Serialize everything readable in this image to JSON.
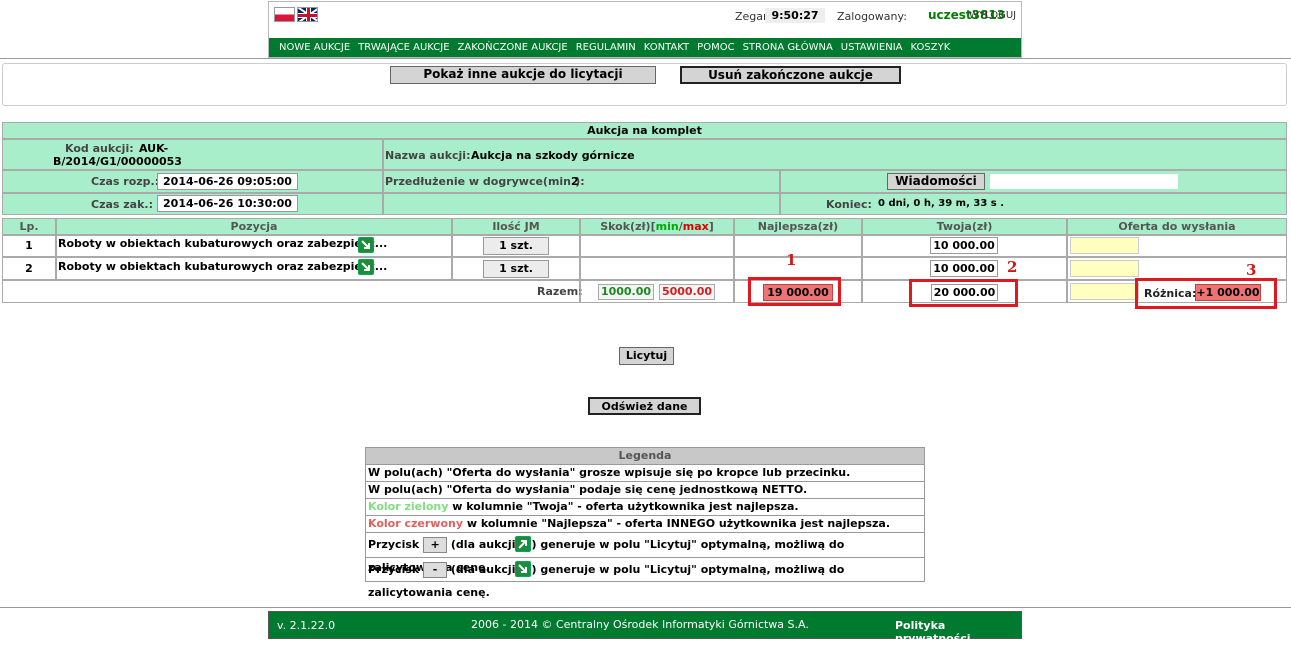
{
  "header": {
    "clock_label": "Zegar:",
    "clock_value": "9:50:27",
    "logged_label": "Zalogowany:",
    "user": "uczest3813",
    "logout": "WYLOGUJ",
    "menu": [
      "NOWE AUKCJE",
      "TRWAJĄCE AUKCJE",
      "ZAKOŃCZONE AUKCJE",
      "REGULAMIN",
      "KONTAKT",
      "POMOC",
      "STRONA GŁÓWNA",
      "USTAWIENIA",
      "KOSZYK"
    ]
  },
  "buttons": {
    "show_other": "Pokaż inne aukcje do licytacji",
    "remove_finished": "Usuń zakończone aukcje",
    "bid": "Licytuj",
    "refresh": "Odśwież dane",
    "messages": "Wiadomości"
  },
  "auction": {
    "title": "Aukcja na komplet",
    "code_label": "Kod aukcji:",
    "code_value": "AUK-B/2014/G1/00000053",
    "name_label": "Nazwa aukcji:",
    "name_value": "Aukcja na szkody górnicze",
    "start_label": "Czas rozp.:",
    "start_value": "2014-06-26 09:05:00",
    "extension_label": "Przedłużenie w dogrywce(min.):",
    "extension_value": "2",
    "end_label": "Czas zak.:",
    "end_value": "2014-06-26 10:30:00",
    "remaining_label": "Koniec:",
    "remaining_value": "0 dni, 0 h, 39 m, 33 s ."
  },
  "table": {
    "columns": [
      "Lp.",
      "Pozycja",
      "Ilość JM",
      "Skok(zł)[",
      "min",
      "/",
      "max",
      "]",
      "Najlepsza(zł)",
      "Twoja(zł)",
      "Oferta do wysłania"
    ],
    "rows": [
      {
        "lp": "1",
        "item": "Roboty w obiektach kubaturowych oraz zabezpiecz...",
        "qty": "1 szt.",
        "yours": "10 000.00"
      },
      {
        "lp": "2",
        "item": "Roboty w obiektach kubaturowych oraz zabezpiecz...",
        "qty": "1 szt.",
        "yours": "10 000.00"
      }
    ],
    "sum_label": "Razem:",
    "sum_min": "1000.00",
    "sum_max": "5000.00",
    "sum_best": "19 000.00",
    "sum_yours": "20 000.00",
    "diff_label": "Różnica:",
    "diff_value": "+1 000.00"
  },
  "annotations": [
    "1",
    "2",
    "3"
  ],
  "legend": {
    "title": "Legenda",
    "row1": "W polu(ach) \"Oferta do wysłania\" grosze wpisuje się po kropce lub przecinku.",
    "row2": "W polu(ach) \"Oferta do wysłania\" podaje się cenę jednostkową NETTO.",
    "row3_colored": "Kolor zielony",
    "row3_rest": " w kolumnie \"Twoja\" - oferta użytkownika jest najlepsza.",
    "row4_colored": "Kolor czerwony",
    "row4_rest": " w kolumnie \"Najlepsza\" - oferta INNEGO użytkownika jest najlepsza.",
    "row5_a": "Przycisk",
    "row5_btn": "+",
    "row5_b": "(dla aukcji",
    "row5_c": ") generuje w polu \"Licytuj\" optymalną, możliwą do zalicytowania cenę.",
    "row6_a": "Przycisk",
    "row6_btn": "-",
    "row6_b": "(dla aukcji",
    "row6_c": ") generuje w polu \"Licytuj\" optymalną, możliwą do zalicytowania cenę."
  },
  "footer": {
    "version": "v. 2.1.22.0",
    "copyright": "2006 - 2014 © Centralny Ośrodek Informatyki Górnictwa S.A.",
    "privacy": "Polityka prywatności"
  },
  "colors": {
    "green_bar": "#007a2f",
    "table_green": "#a9eecb",
    "red": "#e0181f",
    "legend_green": "#7fe07f",
    "legend_red": "#e06060"
  }
}
